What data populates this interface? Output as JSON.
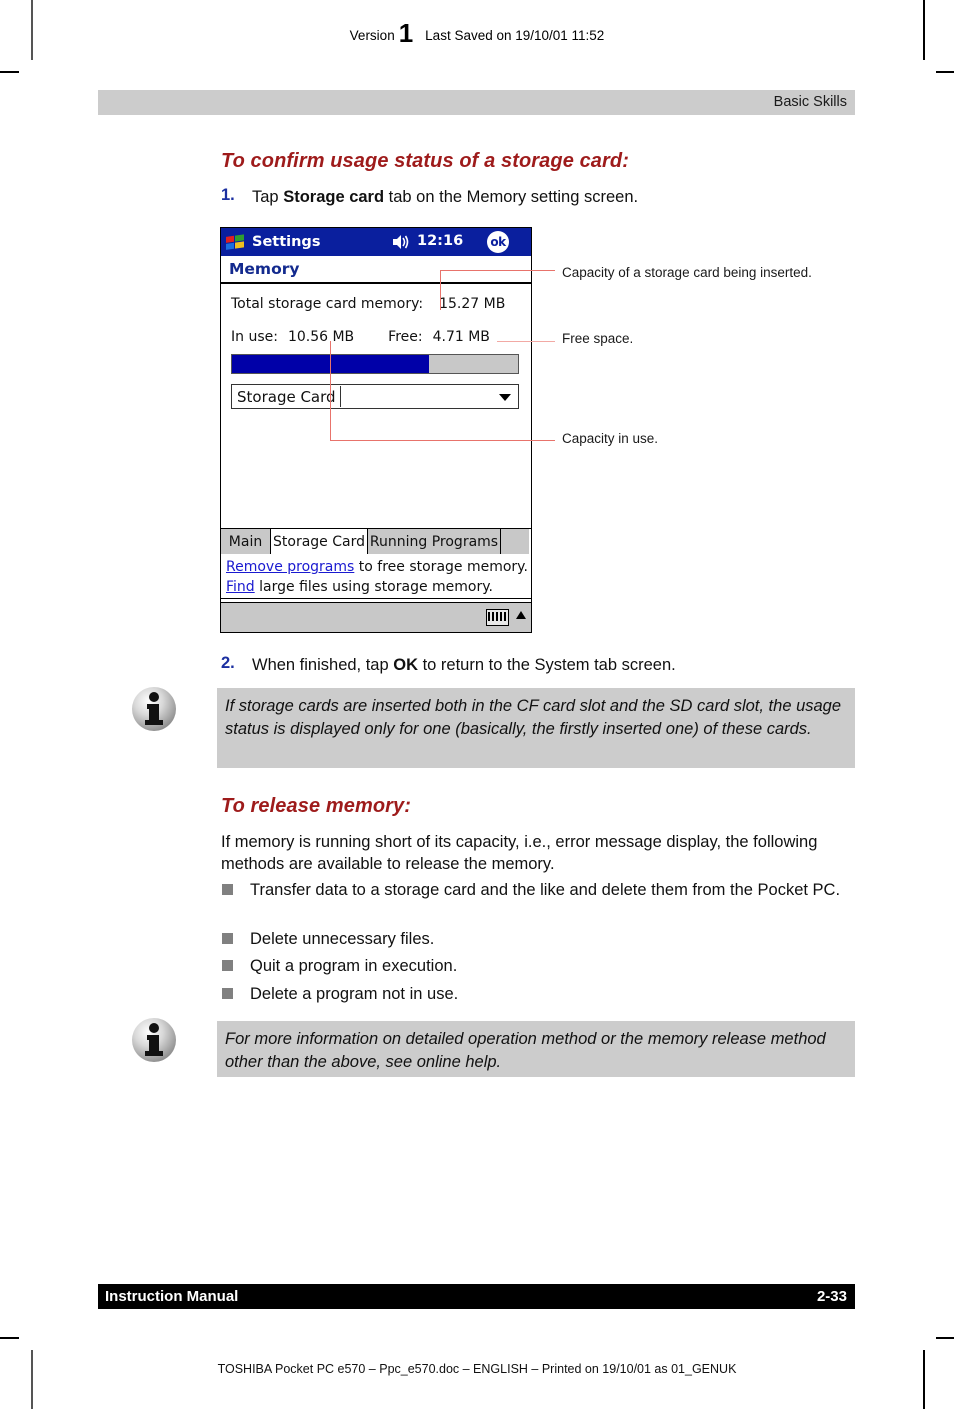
{
  "doc_header": {
    "version_label": "Version",
    "version_number": "1",
    "last_saved": "Last Saved on 19/10/01 11:52"
  },
  "running_head": {
    "chapter": "Basic Skills"
  },
  "section_1": {
    "heading": "To confirm usage status of a storage card:",
    "step1_num": "1.",
    "step1_text_a": "Tap ",
    "step1_text_bold": "Storage card",
    "step1_text_b": " tab on the Memory setting screen.",
    "step2_num": "2.",
    "step2_text_a": "When finished, tap ",
    "step2_text_bold": "OK",
    "step2_text_b": " to return to the System tab screen."
  },
  "device_screen": {
    "title": "Settings",
    "clock": "12:16",
    "ok_button": "ok",
    "screen_name": "Memory",
    "total_label": "Total storage card memory:",
    "total_value": "15.27 MB",
    "inuse_label": "In use:",
    "inuse_value": "10.56 MB",
    "free_label": "Free:",
    "free_value": "4.71 MB",
    "usage_percent": 69,
    "bar_fill_color": "#0000a8",
    "bar_track_color": "#c8c8c8",
    "combo_value": "Storage Card",
    "tabs": [
      {
        "label": "Main",
        "selected": false
      },
      {
        "label": "Storage Card",
        "selected": true
      },
      {
        "label": "Running Programs",
        "selected": false
      }
    ],
    "link_line1_link": "Remove programs",
    "link_line1_rest": " to free storage memory.",
    "link_line2_link": "Find",
    "link_line2_rest": " large files using storage memory."
  },
  "callouts": {
    "capacity_total": "Capacity of a storage card being inserted.",
    "free_space": "Free space.",
    "capacity_in_use": "Capacity in use.",
    "line_color": "#e8736b"
  },
  "note_1": {
    "text": "If storage cards are inserted both in the CF card slot and the SD card slot, the usage status is displayed only for one (basically, the firstly inserted one) of these cards."
  },
  "section_2": {
    "heading": "To release memory:",
    "intro": "If memory is running short of its capacity, i.e., error message display, the following methods are available to release the memory.",
    "bullets": [
      "Transfer data to a storage card and the like and delete them from the Pocket PC.",
      "Delete unnecessary files.",
      "Quit a program in execution.",
      "Delete a program not in use."
    ]
  },
  "note_2": {
    "text": "For more information on detailed operation method or the memory release method other than the above, see online help."
  },
  "footer": {
    "left": "Instruction Manual",
    "right": "2-33",
    "print_line": "TOSHIBA Pocket PC e570  – Ppc_e570.doc – ENGLISH – Printed on 19/10/01 as 01_GENUK"
  },
  "colors": {
    "heading_red": "#9e1b1b",
    "step_number_blue": "#1b2fa0",
    "note_bg": "#cccccc",
    "runhead_bg": "#cccccc"
  }
}
